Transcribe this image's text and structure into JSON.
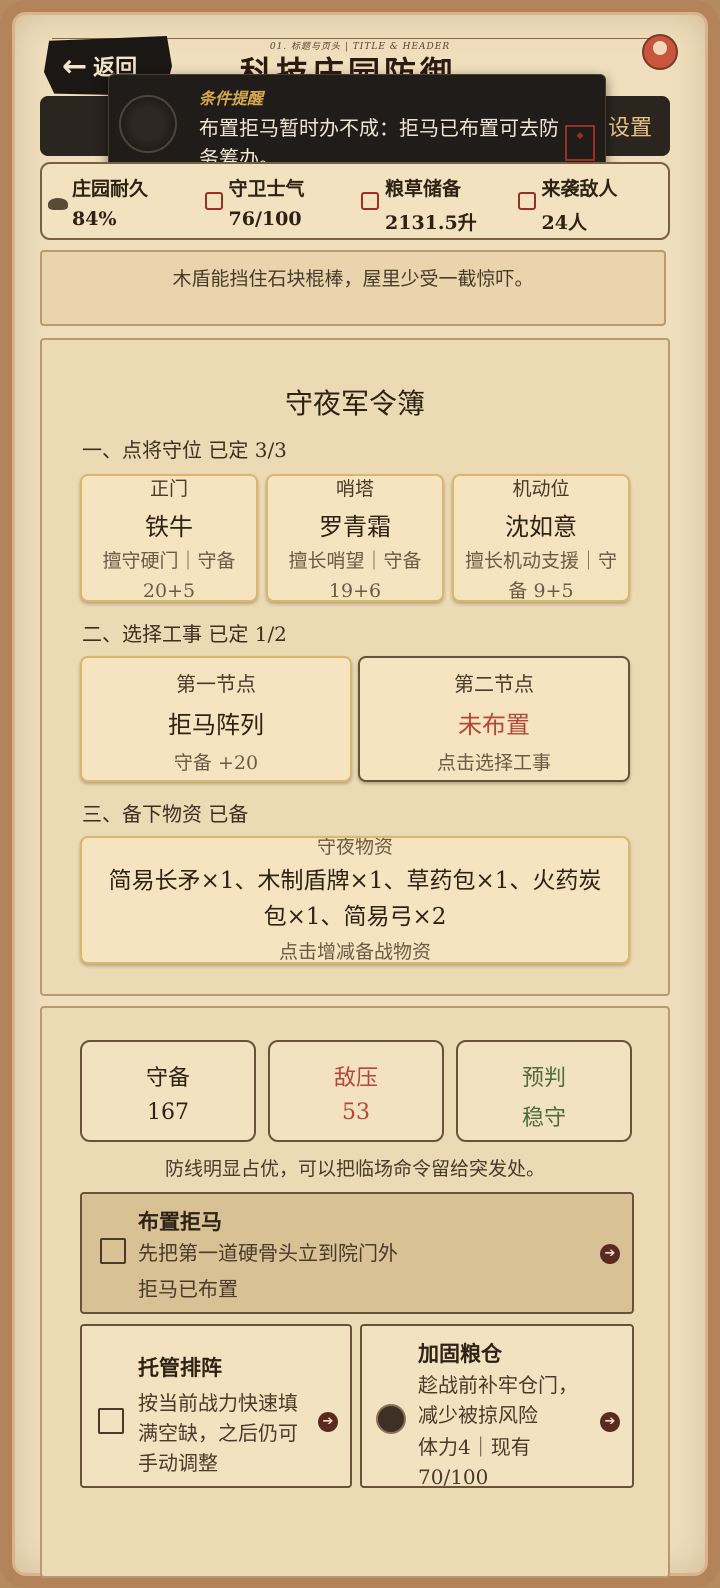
{
  "header": {
    "top_caption": "01. 标题与页头 | TITLE & HEADER",
    "back_label": "返回",
    "title": "科技庄园防御",
    "settings_label": "设置"
  },
  "toast": {
    "title": "条件提醒",
    "body": "布置拒马暂时办不成：拒马已布置可去防务筹办。"
  },
  "stats": [
    {
      "label": "庄园耐久",
      "value": "84%"
    },
    {
      "label": "守卫士气",
      "value": "76/100"
    },
    {
      "label": "粮草储备",
      "value": "2131.5升"
    },
    {
      "label": "来袭敌人",
      "value": "24人"
    }
  ],
  "flavor_text": "木盾能挡住石块棍棒，屋里少受一截惊吓。",
  "ledger": {
    "title": "守夜军令簿",
    "section1": "一、点将守位  已定 3/3",
    "slots": [
      {
        "position": "正门",
        "name": "铁牛",
        "desc": "擅守硬门｜守备 20+5"
      },
      {
        "position": "哨塔",
        "name": "罗青霜",
        "desc": "擅长哨望｜守备 19+6"
      },
      {
        "position": "机动位",
        "name": "沈如意",
        "desc": "擅长机动支援｜守备 9+5"
      }
    ],
    "section2": "二、选择工事  已定 1/2",
    "nodes": [
      {
        "label": "第一节点",
        "name": "拒马阵列",
        "sub": "守备 +20"
      },
      {
        "label": "第二节点",
        "name": "未布置",
        "sub": "点击选择工事"
      }
    ],
    "section3": "三、备下物资  已备",
    "supplies": {
      "label": "守夜物资",
      "items": "简易长矛×1、木制盾牌×1、草药包×1、火药炭包×1、简易弓×2",
      "hint": "点击增减备战物资"
    }
  },
  "battle": {
    "metrics": [
      {
        "label": "守备",
        "value": "167"
      },
      {
        "label": "敌压",
        "value": "53"
      },
      {
        "label": "预判",
        "value": "稳守"
      }
    ],
    "note": "防线明显占优，可以把临场命令留给突发处。",
    "primary_action": {
      "title": "布置拒马",
      "desc": "先把第一道硬骨头立到院门外",
      "status": "拒马已布置"
    },
    "secondary_actions": [
      {
        "title": "托管排阵",
        "desc": "按当前战力快速填满空缺，之后仍可手动调整"
      },
      {
        "title": "加固粮仓",
        "desc": "趁战前补牢仓门，减少被掠风险",
        "cost": "体力4｜现有70/100"
      }
    ]
  },
  "colors": {
    "accent_red": "#b5473a",
    "accent_green": "#4e6d3a",
    "gold": "#e8c47e"
  }
}
